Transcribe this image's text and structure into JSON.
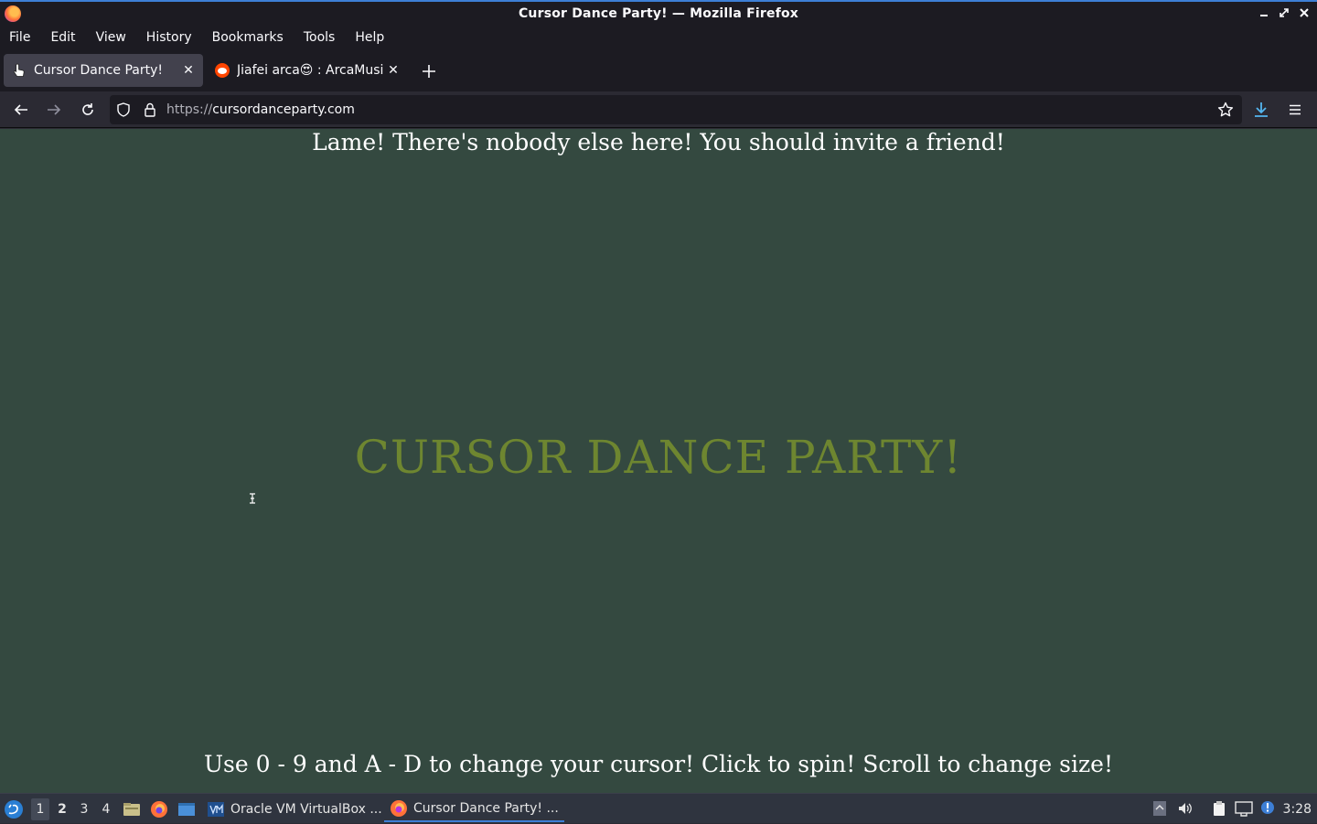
{
  "window": {
    "title": "Cursor Dance Party! — Mozilla Firefox"
  },
  "menu": [
    "File",
    "Edit",
    "View",
    "History",
    "Bookmarks",
    "Tools",
    "Help"
  ],
  "tabs": [
    {
      "label": "Cursor Dance Party!",
      "active": true
    },
    {
      "label": "Jiafei arca😍 : ArcaMusic",
      "active": false
    }
  ],
  "navbar": {
    "url_scheme": "https://",
    "url_host": "cursordanceparty.com"
  },
  "page": {
    "notice": "Lame! There's nobody else here! You should invite a friend!",
    "title": "CURSOR DANCE PARTY!",
    "instructions": "Use 0 - 9 and A - D to change your cursor! Click to spin! Scroll to change size!"
  },
  "taskbar": {
    "workspaces": [
      "1",
      "2",
      "3",
      "4"
    ],
    "tasks": [
      {
        "label": "Oracle VM VirtualBox ...",
        "active": false
      },
      {
        "label": "Cursor Dance Party! ...",
        "active": true
      }
    ],
    "clock": "3:28"
  },
  "colors": {
    "page_background": "#344940",
    "title_color": "#6e8630",
    "accent": "#3d7fd6"
  }
}
